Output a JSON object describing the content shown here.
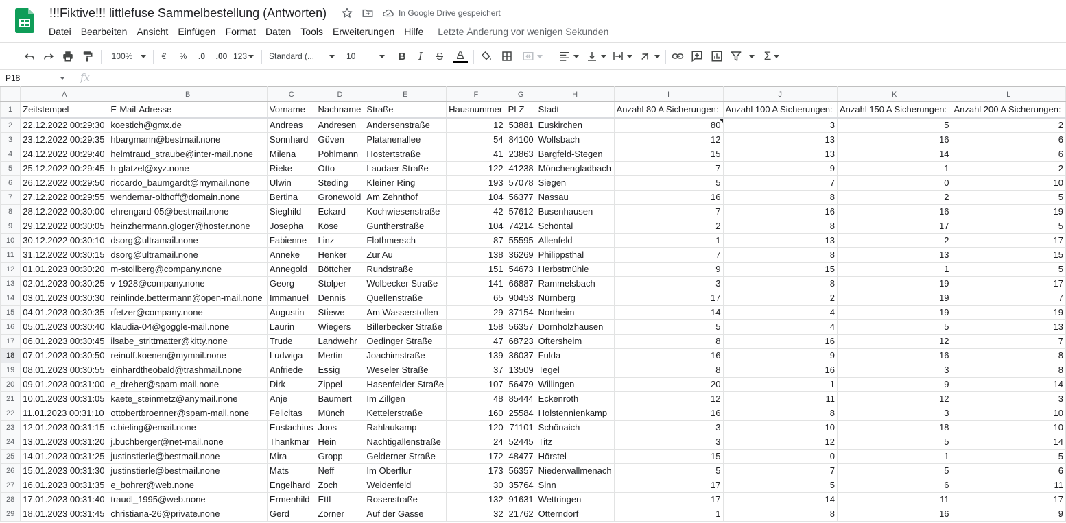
{
  "app": {
    "doc_title": "!!!Fiktive!!! littlefuse Sammelbestellung (Antworten)",
    "save_status": "In Google Drive gespeichert",
    "last_edit": "Letzte Änderung vor wenigen Sekunden",
    "accent_color": "#188038"
  },
  "menu": [
    "Datei",
    "Bearbeiten",
    "Ansicht",
    "Einfügen",
    "Format",
    "Daten",
    "Tools",
    "Erweiterungen",
    "Hilfe"
  ],
  "toolbar": {
    "zoom": "100%",
    "currency": "€",
    "percent": "%",
    "decimal_decrease": ".0",
    "decimal_increase": ".00",
    "more_formats": "123",
    "font": "Standard (...",
    "font_size": "10",
    "bold": "B",
    "italic": "I",
    "strike": "S",
    "text_color": "A",
    "sum": "Σ"
  },
  "formula_bar": {
    "name_box": "P18",
    "fx": "fx",
    "value": ""
  },
  "grid": {
    "columns": [
      "A",
      "B",
      "C",
      "D",
      "E",
      "F",
      "G",
      "H",
      "I",
      "J",
      "K",
      "L"
    ],
    "headers": [
      "Zeitstempel",
      "E-Mail-Adresse",
      "Vorname",
      "Nachname",
      "Straße",
      "Hausnummer",
      "PLZ",
      "Stadt",
      "Anzahl 80 A Sicherungen:",
      "Anzahl 100 A Sicherungen:",
      "Anzahl 150 A Sicherungen:",
      "Anzahl 200 A Sicherungen:"
    ],
    "selected_row": 18,
    "rows": [
      [
        "22.12.2022 00:29:30",
        "koestich@gmx.de",
        "Andreas",
        "Andresen",
        "Andersenstraße",
        "12",
        "53881",
        "Euskirchen",
        "80",
        "3",
        "5",
        "2"
      ],
      [
        "23.12.2022 00:29:35",
        "hbargmann@bestmail.none",
        "Sonnhard",
        "Güven",
        "Platanenallee",
        "54",
        "84100",
        "Wolfsbach",
        "12",
        "13",
        "16",
        "6"
      ],
      [
        "24.12.2022 00:29:40",
        "helmtraud_straube@inter-mail.none",
        "Milena",
        "Pöhlmann",
        "Hostertstraße",
        "41",
        "23863",
        "Bargfeld-Stegen",
        "15",
        "13",
        "14",
        "6"
      ],
      [
        "25.12.2022 00:29:45",
        "h-glatzel@xyz.none",
        "Rieke",
        "Otto",
        "Laudaer Straße",
        "122",
        "41238",
        "Mönchengladbach",
        "7",
        "9",
        "1",
        "2"
      ],
      [
        "26.12.2022 00:29:50",
        "riccardo_baumgardt@mymail.none",
        "Ulwin",
        "Steding",
        "Kleiner Ring",
        "193",
        "57078",
        "Siegen",
        "5",
        "7",
        "0",
        "10"
      ],
      [
        "27.12.2022 00:29:55",
        "wendemar-olthoff@domain.none",
        "Bertina",
        "Gronewold",
        "Am Zehnthof",
        "104",
        "56377",
        "Nassau",
        "16",
        "8",
        "2",
        "5"
      ],
      [
        "28.12.2022 00:30:00",
        "ehrengard-05@bestmail.none",
        "Sieghild",
        "Eckard",
        "Kochwiesenstraße",
        "42",
        "57612",
        "Busenhausen",
        "7",
        "16",
        "16",
        "19"
      ],
      [
        "29.12.2022 00:30:05",
        "heinzhermann.gloger@hoster.none",
        "Josepha",
        "Köse",
        "Guntherstraße",
        "104",
        "74214",
        "Schöntal",
        "2",
        "8",
        "17",
        "5"
      ],
      [
        "30.12.2022 00:30:10",
        "dsorg@ultramail.none",
        "Fabienne",
        "Linz",
        "Flothmersch",
        "87",
        "55595",
        "Allenfeld",
        "1",
        "13",
        "2",
        "17"
      ],
      [
        "31.12.2022 00:30:15",
        "dsorg@ultramail.none",
        "Anneke",
        "Henker",
        "Zur Au",
        "138",
        "36269",
        "Philippsthal",
        "7",
        "8",
        "13",
        "15"
      ],
      [
        "01.01.2023 00:30:20",
        "m-stollberg@company.none",
        "Annegold",
        "Böttcher",
        "Rundstraße",
        "151",
        "54673",
        "Herbstmühle",
        "9",
        "15",
        "1",
        "5"
      ],
      [
        "02.01.2023 00:30:25",
        "v-1928@company.none",
        "Georg",
        "Stolper",
        "Wolbecker Straße",
        "141",
        "66887",
        "Rammelsbach",
        "3",
        "8",
        "19",
        "17"
      ],
      [
        "03.01.2023 00:30:30",
        "reinlinde.bettermann@open-mail.none",
        "Immanuel",
        "Dennis",
        "Quellenstraße",
        "65",
        "90453",
        "Nürnberg",
        "17",
        "2",
        "19",
        "7"
      ],
      [
        "04.01.2023 00:30:35",
        "rfetzer@company.none",
        "Augustin",
        "Stiewe",
        "Am Wasserstollen",
        "29",
        "37154",
        "Northeim",
        "14",
        "4",
        "19",
        "19"
      ],
      [
        "05.01.2023 00:30:40",
        "klaudia-04@goggle-mail.none",
        "Laurin",
        "Wiegers",
        "Billerbecker Straße",
        "158",
        "56357",
        "Dornholzhausen",
        "5",
        "4",
        "5",
        "13"
      ],
      [
        "06.01.2023 00:30:45",
        "ilsabe_strittmatter@kitty.none",
        "Trude",
        "Landwehr",
        "Oedinger Straße",
        "47",
        "68723",
        "Oftersheim",
        "8",
        "16",
        "12",
        "7"
      ],
      [
        "07.01.2023 00:30:50",
        "reinulf.koenen@mymail.none",
        "Ludwiga",
        "Mertin",
        "Joachimstraße",
        "139",
        "36037",
        "Fulda",
        "16",
        "9",
        "16",
        "8"
      ],
      [
        "08.01.2023 00:30:55",
        "einhardtheobald@trashmail.none",
        "Anfriede",
        "Essig",
        "Weseler Straße",
        "37",
        "13509",
        "Tegel",
        "8",
        "16",
        "3",
        "8"
      ],
      [
        "09.01.2023 00:31:00",
        "e_dreher@spam-mail.none",
        "Dirk",
        "Zippel",
        "Hasenfelder Straße",
        "107",
        "56479",
        "Willingen",
        "20",
        "1",
        "9",
        "14"
      ],
      [
        "10.01.2023 00:31:05",
        "kaete_steinmetz@anymail.none",
        "Anje",
        "Baumert",
        "Im Zillgen",
        "48",
        "85444",
        "Eckenroth",
        "12",
        "11",
        "12",
        "3"
      ],
      [
        "11.01.2023 00:31:10",
        "ottobertbroenner@spam-mail.none",
        "Felicitas",
        "Münch",
        "Kettelerstraße",
        "160",
        "25584",
        "Holstennienkamp",
        "16",
        "8",
        "3",
        "10"
      ],
      [
        "12.01.2023 00:31:15",
        "c.bieling@email.none",
        "Eustachius",
        "Joos",
        "Rahlaukamp",
        "120",
        "71101",
        "Schönaich",
        "3",
        "10",
        "18",
        "10"
      ],
      [
        "13.01.2023 00:31:20",
        "j.buchberger@net-mail.none",
        "Thankmar",
        "Hein",
        "Nachtigallenstraße",
        "24",
        "52445",
        "Titz",
        "3",
        "12",
        "5",
        "14"
      ],
      [
        "14.01.2023 00:31:25",
        "justinstierle@bestmail.none",
        "Mira",
        "Gropp",
        "Gelderner Straße",
        "172",
        "48477",
        "Hörstel",
        "15",
        "0",
        "1",
        "5"
      ],
      [
        "15.01.2023 00:31:30",
        "justinstierle@bestmail.none",
        "Mats",
        "Neff",
        "Im Oberflur",
        "173",
        "56357",
        "Niederwallmenach",
        "5",
        "7",
        "5",
        "6"
      ],
      [
        "16.01.2023 00:31:35",
        "e_bohrer@web.none",
        "Engelhard",
        "Zoch",
        "Weidenfeld",
        "30",
        "35764",
        "Sinn",
        "17",
        "5",
        "6",
        "11"
      ],
      [
        "17.01.2023 00:31:40",
        "traudl_1995@web.none",
        "Ermenhild",
        "Ettl",
        "Rosenstraße",
        "132",
        "91631",
        "Wettringen",
        "17",
        "14",
        "11",
        "17"
      ],
      [
        "18.01.2023 00:31:45",
        "christiana-26@private.none",
        "Gerd",
        "Zörner",
        "Auf der Gasse",
        "32",
        "21762",
        "Otterndorf",
        "1",
        "8",
        "16",
        "9"
      ]
    ]
  }
}
